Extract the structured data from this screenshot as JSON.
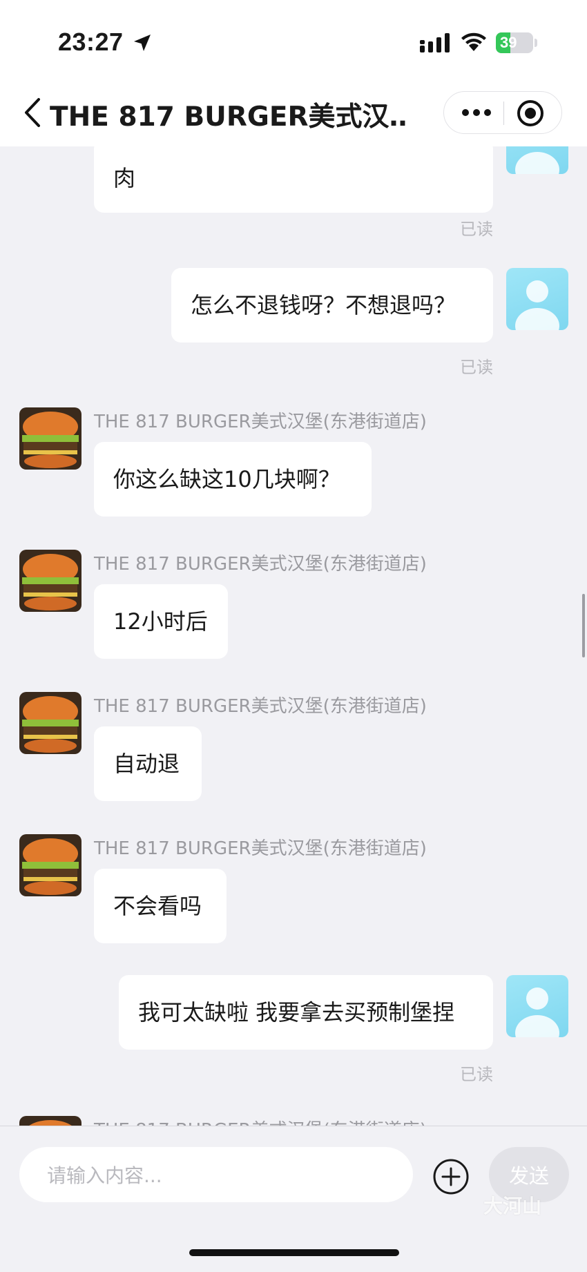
{
  "status_bar": {
    "time": "23:27",
    "battery": "39",
    "battery_level": 0.39
  },
  "nav": {
    "title": "THE 817 BURGER美式汉…"
  },
  "read_label": "已读",
  "shop_name": "THE 817 BURGER美式汉堡(东港街道店)",
  "messages": [
    {
      "from": "shop",
      "text": "肉"
    },
    {
      "from": "user",
      "text": "怎么不退钱呀？不想退吗？"
    },
    {
      "from": "shop",
      "text": "你这么缺这10几块啊？"
    },
    {
      "from": "shop",
      "text": "12小时后"
    },
    {
      "from": "shop",
      "text": "自动退"
    },
    {
      "from": "shop",
      "text": "不会看吗"
    },
    {
      "from": "user",
      "text": "我可太缺啦 我要拿去买预制堡捏"
    }
  ],
  "input": {
    "placeholder": "请输入内容...",
    "send_label": "发送"
  },
  "watermark": "大河山",
  "colors": {
    "bg": "#f1f1f5",
    "bubble": "#ffffff",
    "battery_green": "#34c759"
  }
}
